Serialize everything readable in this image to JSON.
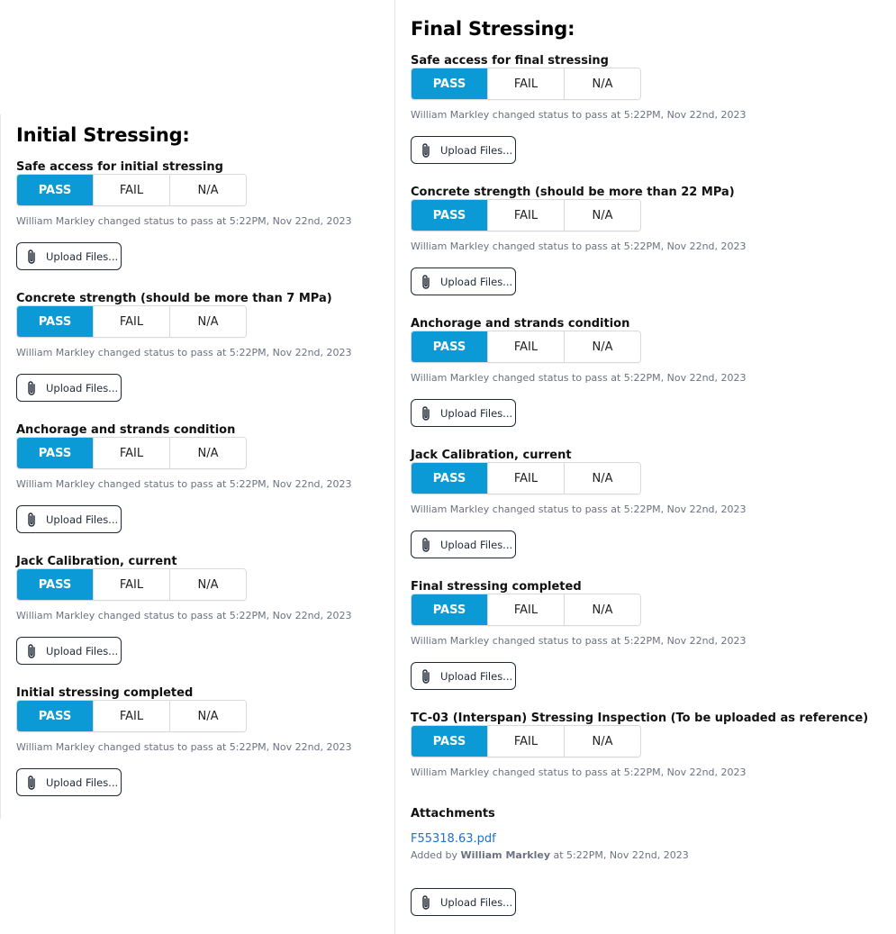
{
  "colors": {
    "accent": "#0b9ad6",
    "link": "#1d6fd1",
    "muted": "#6b7280"
  },
  "options": {
    "pass": "PASS",
    "fail": "FAIL",
    "na": "N/A"
  },
  "upload_label": "Upload Files...",
  "initial": {
    "title": "Initial Stressing:",
    "items": [
      {
        "label": "Safe access for initial stressing",
        "selected": "PASS",
        "status": "William Markley changed status to pass at 5:22PM, Nov 22nd, 2023"
      },
      {
        "label": "Concrete strength (should be more than 7 MPa)",
        "selected": "PASS",
        "status": "William Markley changed status to pass at 5:22PM, Nov 22nd, 2023"
      },
      {
        "label": "Anchorage and strands condition",
        "selected": "PASS",
        "status": "William Markley changed status to pass at 5:22PM, Nov 22nd, 2023"
      },
      {
        "label": "Jack Calibration, current",
        "selected": "PASS",
        "status": "William Markley changed status to pass at 5:22PM, Nov 22nd, 2023"
      },
      {
        "label": "Initial stressing completed",
        "selected": "PASS",
        "status": "William Markley changed status to pass at 5:22PM, Nov 22nd, 2023"
      }
    ]
  },
  "final": {
    "title": "Final Stressing:",
    "items": [
      {
        "label": "Safe access for final stressing",
        "selected": "PASS",
        "status": "William Markley changed status to pass at 5:22PM, Nov 22nd, 2023"
      },
      {
        "label": "Concrete strength (should be more than 22 MPa)",
        "selected": "PASS",
        "status": "William Markley changed status to pass at 5:22PM, Nov 22nd, 2023"
      },
      {
        "label": "Anchorage and strands condition",
        "selected": "PASS",
        "status": "William Markley changed status to pass at 5:22PM, Nov 22nd, 2023"
      },
      {
        "label": "Jack Calibration, current",
        "selected": "PASS",
        "status": "William Markley changed status to pass at 5:22PM, Nov 22nd, 2023"
      },
      {
        "label": "Final stressing completed",
        "selected": "PASS",
        "status": "William Markley changed status to pass at 5:22PM, Nov 22nd, 2023"
      },
      {
        "label": "TC-03 (Interspan) Stressing Inspection (To be uploaded as reference)",
        "selected": "PASS",
        "status": "William Markley changed status to pass at 5:22PM, Nov 22nd, 2023"
      }
    ],
    "attachments": {
      "heading": "Attachments",
      "file_name": "F55318.63.pdf",
      "added_prefix": "Added by",
      "added_user": "William Markley",
      "added_suffix": "at 5:22PM, Nov 22nd, 2023"
    }
  }
}
